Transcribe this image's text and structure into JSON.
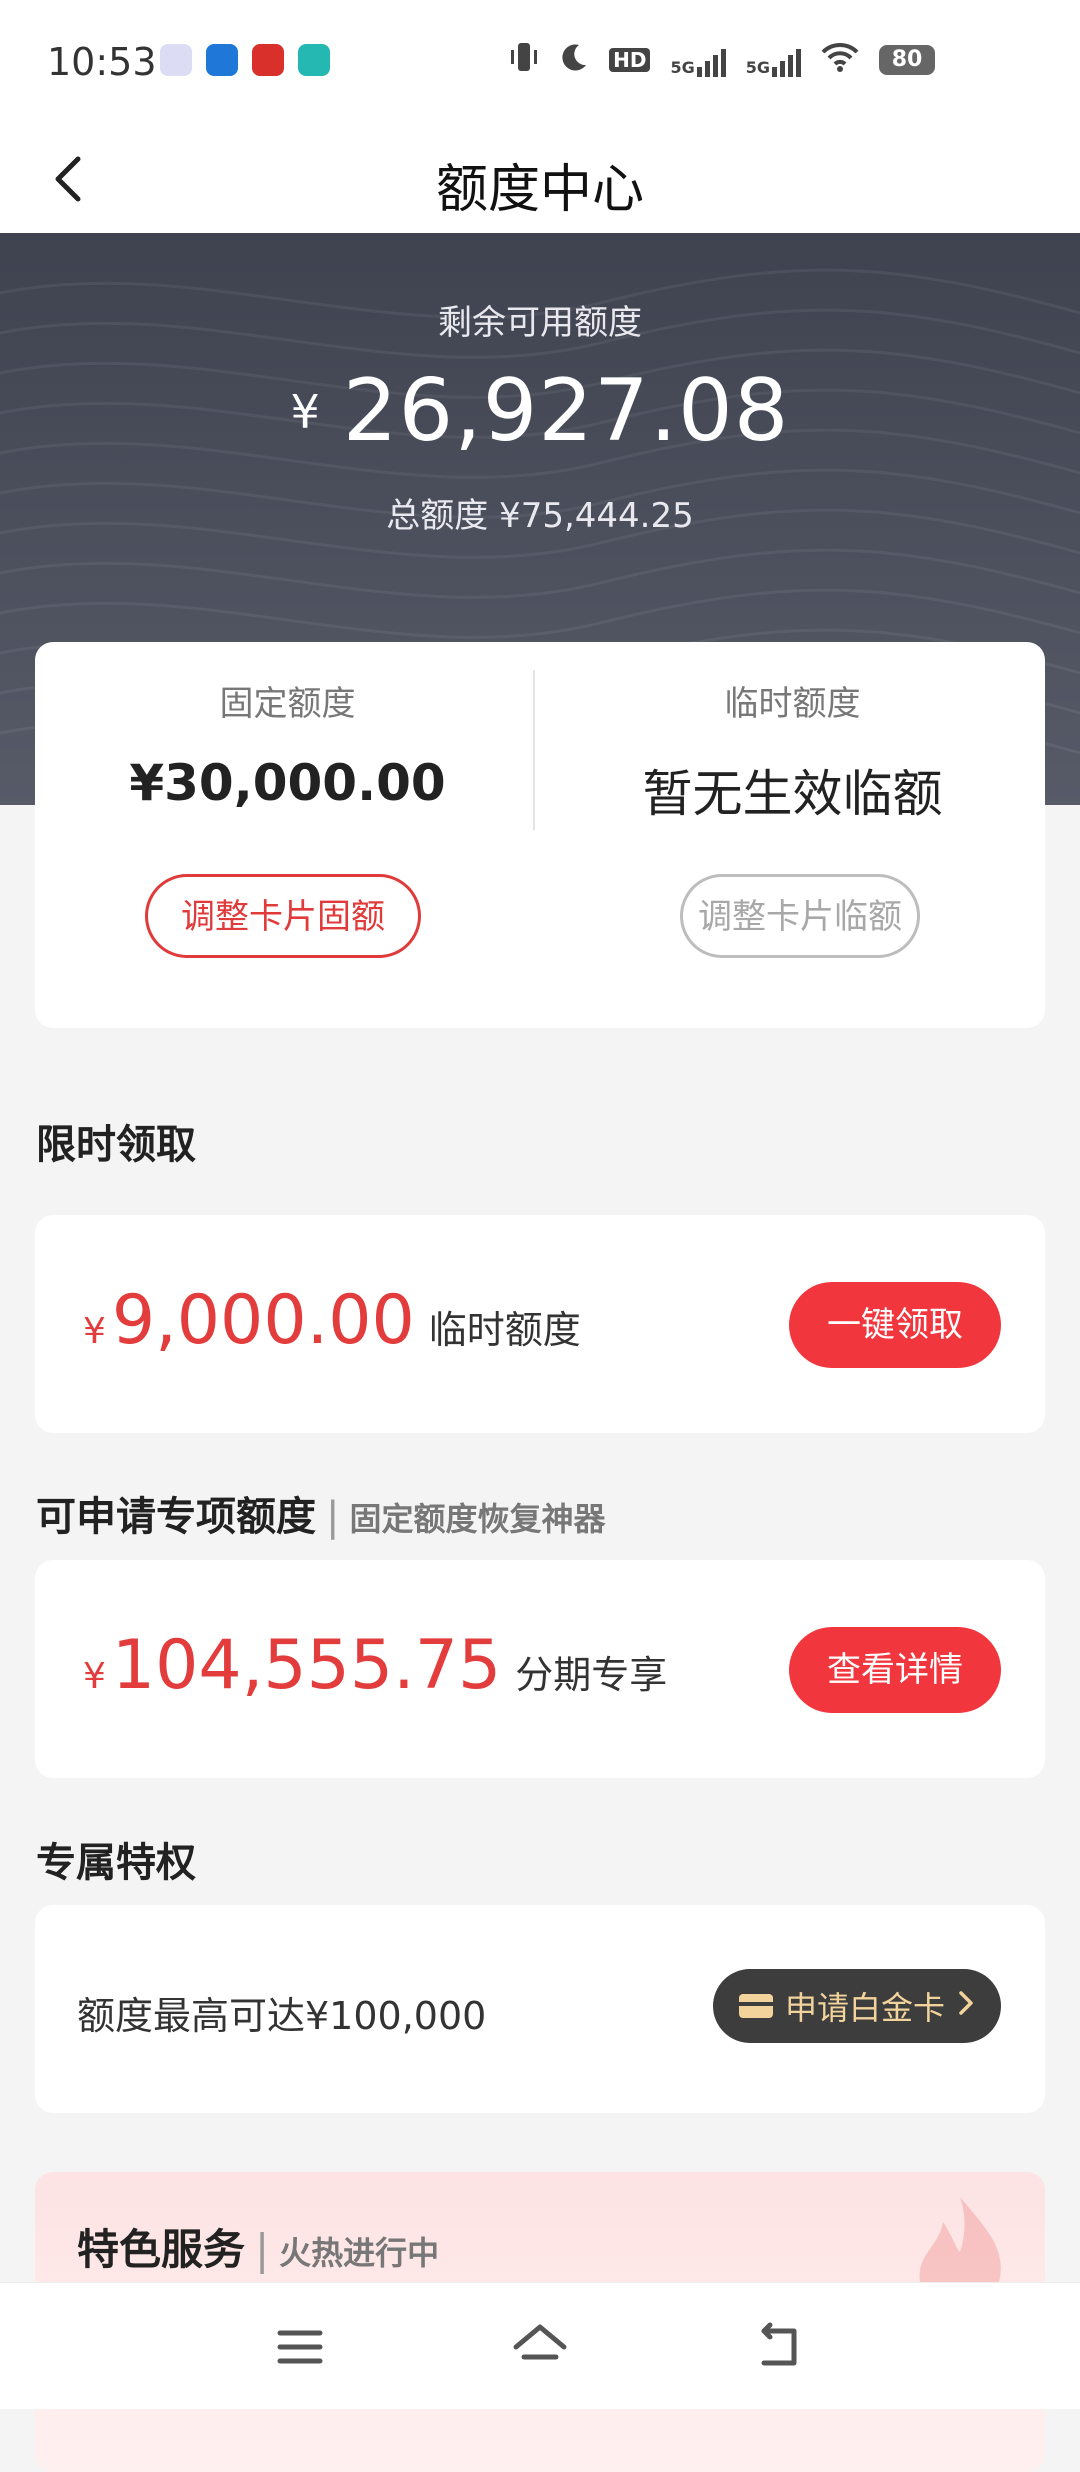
{
  "status_bar": {
    "time": "10:53",
    "network_5g_1": "5G",
    "network_5g_2": "5G",
    "hd_label": "HD",
    "battery": "80"
  },
  "header": {
    "title": "额度中心"
  },
  "hero": {
    "label": "剩余可用额度",
    "currency": "¥",
    "amount": "26,927.08",
    "total_text": "总额度 ¥75,444.25"
  },
  "limits": {
    "fixed": {
      "title": "固定额度",
      "value": "¥30,000.00",
      "button": "调整卡片固额"
    },
    "temporary": {
      "title": "临时额度",
      "value": "暂无生效临额",
      "button": "调整卡片临额"
    }
  },
  "limited_offer": {
    "section_title": "限时领取",
    "currency": "¥",
    "amount": "9,000.00",
    "desc": "临时额度",
    "button": "一键领取"
  },
  "special_limit": {
    "section_title": "可申请专项额度",
    "section_sub": "固定额度恢复神器",
    "currency": "¥",
    "amount": "104,555.75",
    "desc": "分期专享",
    "button": "查看详情"
  },
  "privileges": {
    "section_title": "专属特权",
    "text": "额度最高可达¥100,000",
    "button": "申请白金卡"
  },
  "featured": {
    "title": "特色服务",
    "sub": "火热进行中"
  },
  "colors": {
    "accent_red": "#f2363d",
    "hero_bg": "#4a4e5b",
    "gold": "#f3d39c"
  }
}
